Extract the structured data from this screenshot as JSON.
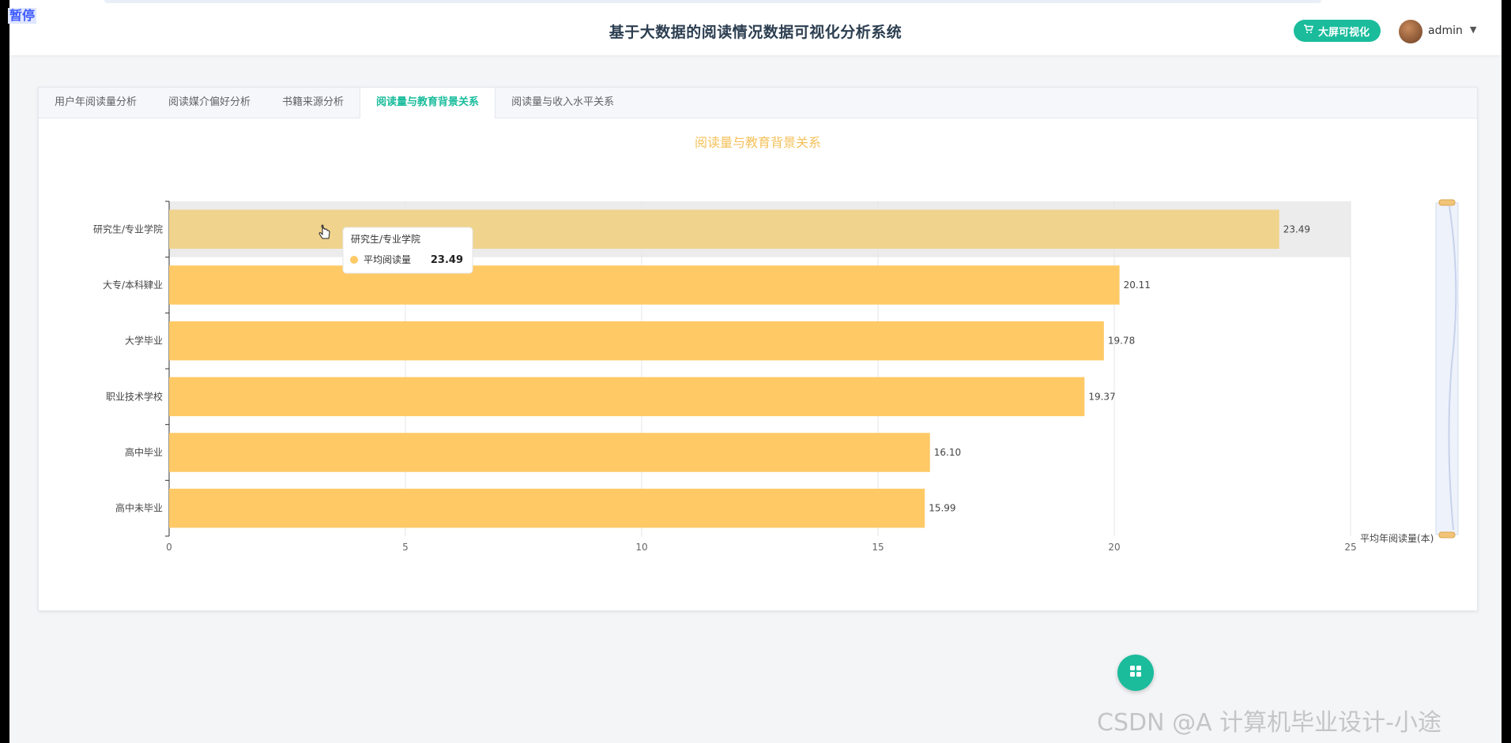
{
  "overlay": {
    "pause_label": "暂停"
  },
  "header": {
    "title": "基于大数据的阅读情况数据可视化分析系统",
    "bigscreen_button": "大屏可视化",
    "user_name": "admin",
    "accent_color": "#1abc9c"
  },
  "tabs": [
    {
      "label": "用户年阅读量分析",
      "active": false
    },
    {
      "label": "阅读媒介偏好分析",
      "active": false
    },
    {
      "label": "书籍来源分析",
      "active": false
    },
    {
      "label": "阅读量与教育背景关系",
      "active": true
    },
    {
      "label": "阅读量与收入水平关系",
      "active": false
    }
  ],
  "chart_data": {
    "type": "bar",
    "orientation": "horizontal",
    "title": "阅读量与教育背景关系",
    "categories": [
      "研究生/专业学院",
      "大专/本科肄业",
      "大学毕业",
      "职业技术学校",
      "高中毕业",
      "高中未毕业"
    ],
    "series": [
      {
        "name": "平均阅读量",
        "values": [
          23.49,
          20.11,
          19.78,
          19.37,
          16.1,
          15.99
        ],
        "color": "#ffc966"
      }
    ],
    "xlabel": "平均年阅读量(本)",
    "ylabel": "",
    "xlim": [
      0,
      25
    ],
    "xticks": [
      0,
      5,
      10,
      15,
      20,
      25
    ],
    "grid": true,
    "highlighted_category": "研究生/专业学院",
    "tooltip": {
      "title": "研究生/专业学院",
      "series": "平均阅读量",
      "value": "23.49"
    }
  },
  "watermark": "CSDN @A 计算机毕业设计-小途"
}
